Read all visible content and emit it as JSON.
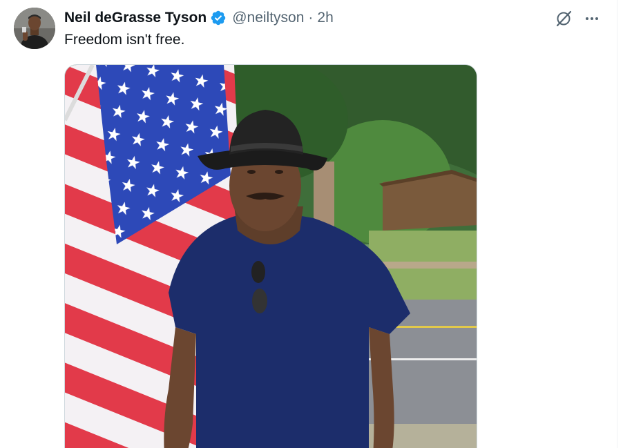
{
  "author": {
    "display_name": "Neil deGrasse Tyson",
    "handle": "@neiltyson",
    "separator": "·",
    "timestamp": "2h",
    "verified": true
  },
  "tweet": {
    "text": "Freedom isn't free."
  },
  "icons": {
    "verified": "verified-badge-icon",
    "grok": "grok-icon",
    "more": "more-options-icon"
  },
  "colors": {
    "verified_blue": "#1d9bf0",
    "secondary_text": "#536471",
    "primary_text": "#0f1419"
  }
}
